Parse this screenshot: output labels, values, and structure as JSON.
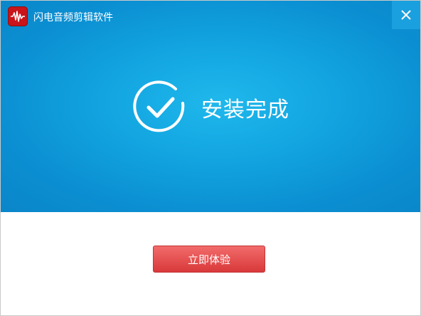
{
  "window": {
    "title": "闪电音频剪辑软件",
    "logo_icon": "audio-waveform-icon",
    "close_icon": "close-icon"
  },
  "main": {
    "status_icon": "check-circle-icon",
    "status_text": "安装完成"
  },
  "footer": {
    "primary_button_label": "立即体验"
  },
  "colors": {
    "hero_bg": "#0b8fd2",
    "logo_bg": "#c8141a",
    "button_bg": "#e04a4a",
    "text_on_dark": "#ffffff"
  }
}
